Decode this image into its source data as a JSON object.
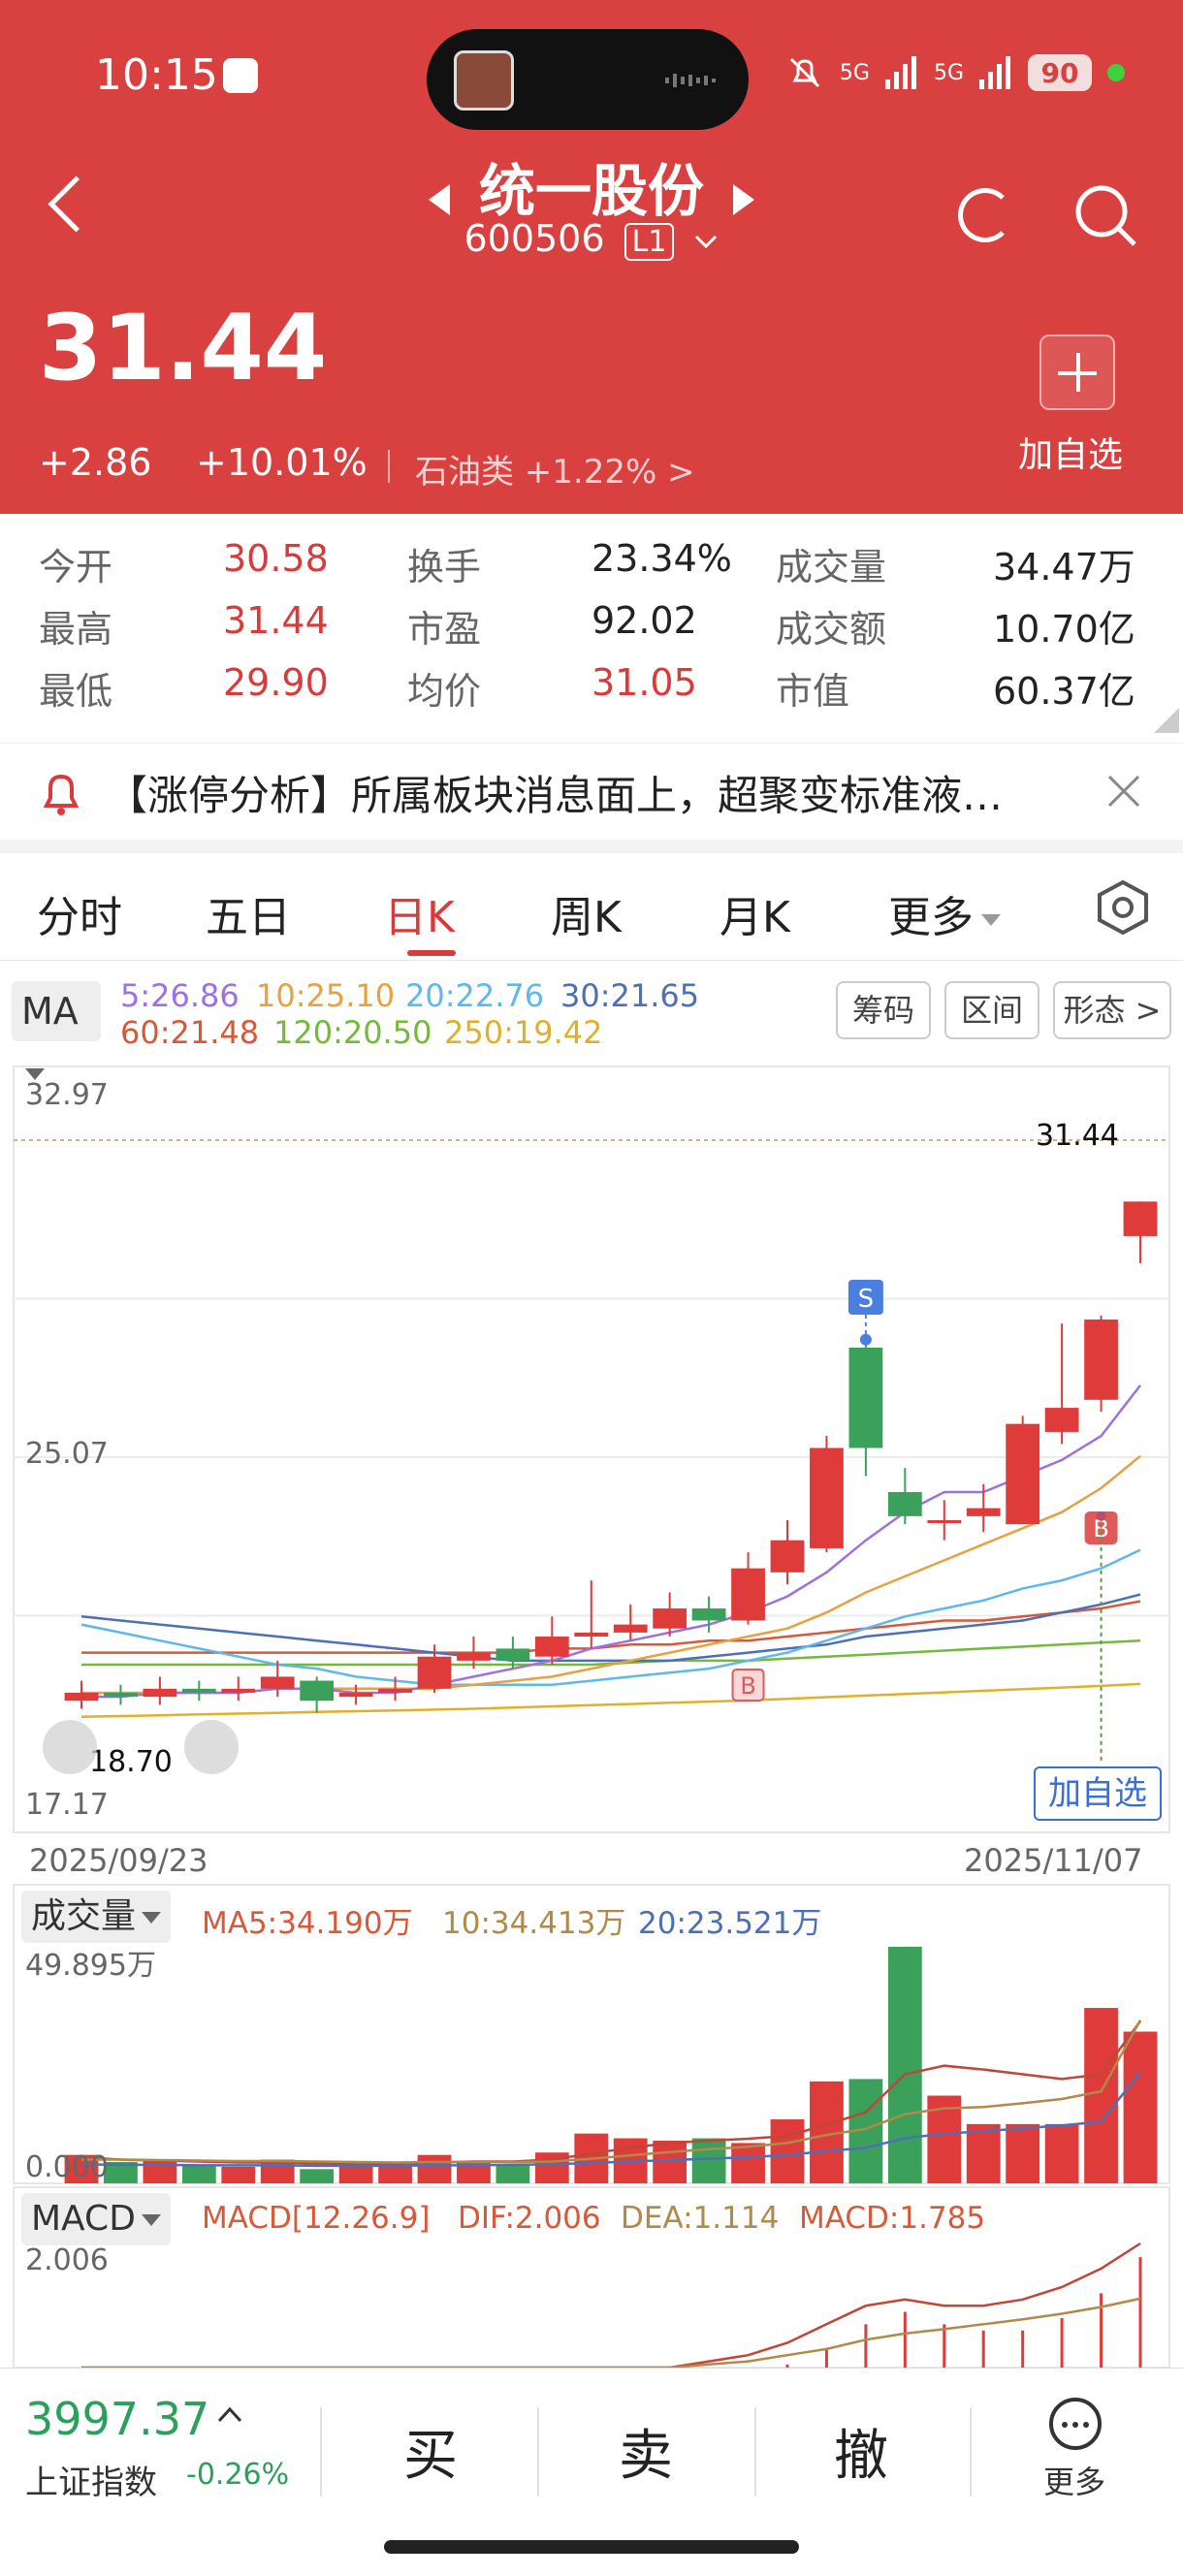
{
  "status_bar": {
    "time": "10:15",
    "battery": "90",
    "signal1": "5G",
    "signal2": "5G"
  },
  "header": {
    "title": "统一股份",
    "code": "600506",
    "level": "L1",
    "price": "31.44",
    "change": "+2.86",
    "change_pct": "+10.01%",
    "sector": "石油类 +1.22% >",
    "add_watch": "加自选"
  },
  "stats": [
    {
      "label": "今开",
      "value": "30.58",
      "color": "red"
    },
    {
      "label": "换手",
      "value": "23.34%",
      "color": "black"
    },
    {
      "label": "成交量",
      "value": "34.47万",
      "color": "black"
    },
    {
      "label": "最高",
      "value": "31.44",
      "color": "red"
    },
    {
      "label": "市盈",
      "value": "92.02",
      "color": "black"
    },
    {
      "label": "成交额",
      "value": "10.70亿",
      "color": "black"
    },
    {
      "label": "最低",
      "value": "29.90",
      "color": "red"
    },
    {
      "label": "均价",
      "value": "31.05",
      "color": "red"
    },
    {
      "label": "市值",
      "value": "60.37亿",
      "color": "black"
    }
  ],
  "news": {
    "text": "【涨停分析】所属板块消息面上，超聚变标准液…"
  },
  "tabs": {
    "t1": "分时",
    "t2": "五日",
    "t3": "日K",
    "t4": "周K",
    "t5": "月K",
    "t6": "更多",
    "active": "日K"
  },
  "ma": {
    "btn": "MA",
    "ma5": "5:26.86",
    "ma10": "10:25.10",
    "ma20": "20:22.76",
    "ma30": "30:21.65",
    "ma60": "60:21.48",
    "ma120": "120:20.50",
    "ma250": "250:19.42",
    "btn_chip": "筹码",
    "btn_range": "区间",
    "btn_pattern": "形态 >"
  },
  "axes": {
    "y_top": "32.97",
    "y_mid": "25.07",
    "y_bottom": "17.17",
    "low_mark": "18.70",
    "high_mark": "31.44",
    "date_start": "2025/09/23",
    "date_end": "2025/11/07",
    "sell_marker": "S",
    "buy_marker": "B",
    "add_watch_chart": "加自选"
  },
  "volume": {
    "btn": "成交量",
    "ma5": "MA5:34.190万",
    "ma10": "10:34.413万",
    "ma20": "20:23.521万",
    "max": "49.895万",
    "zero": "0.000"
  },
  "macd": {
    "btn": "MACD",
    "params": "MACD[12.26.9]",
    "dif": "DIF:2.006",
    "dea": "DEA:1.114",
    "macd": "MACD:1.785",
    "max": "2.006"
  },
  "bottom": {
    "index_value": "3997.37",
    "index_name": "上证指数",
    "index_change": "-0.26%",
    "buy": "买",
    "sell": "卖",
    "cancel": "撤",
    "more": "更多"
  },
  "colors": {
    "header_red": "#d94040",
    "up": "#e03b3b",
    "down": "#3aa05a",
    "ma5": "#9b72e0",
    "ma10": "#e8a040",
    "ma20": "#5fb8e8",
    "ma30": "#4d6fb8",
    "ma60": "#d65a3a",
    "ma120": "#76b83a",
    "ma250": "#e0b02a"
  },
  "chart_data": {
    "type": "candlestick",
    "x_range": [
      "2025/09/23",
      "2025/11/07"
    ],
    "ylim": [
      17.17,
      32.97
    ],
    "candles": [
      {
        "o": 19.0,
        "c": 19.2,
        "h": 19.5,
        "l": 18.8
      },
      {
        "o": 19.2,
        "c": 19.1,
        "h": 19.4,
        "l": 18.9
      },
      {
        "o": 19.1,
        "c": 19.3,
        "h": 19.6,
        "l": 18.9
      },
      {
        "o": 19.3,
        "c": 19.2,
        "h": 19.5,
        "l": 19.0
      },
      {
        "o": 19.2,
        "c": 19.3,
        "h": 19.6,
        "l": 19.0
      },
      {
        "o": 19.3,
        "c": 19.6,
        "h": 20.0,
        "l": 19.1
      },
      {
        "o": 19.5,
        "c": 19.0,
        "h": 19.6,
        "l": 18.7
      },
      {
        "o": 19.1,
        "c": 19.2,
        "h": 19.4,
        "l": 18.9
      },
      {
        "o": 19.2,
        "c": 19.3,
        "h": 19.6,
        "l": 19.0
      },
      {
        "o": 19.3,
        "c": 20.1,
        "h": 20.4,
        "l": 19.2
      },
      {
        "o": 20.0,
        "c": 20.2,
        "h": 20.6,
        "l": 19.8
      },
      {
        "o": 20.3,
        "c": 20.0,
        "h": 20.6,
        "l": 19.8
      },
      {
        "o": 20.1,
        "c": 20.6,
        "h": 21.1,
        "l": 19.9
      },
      {
        "o": 20.6,
        "c": 20.7,
        "h": 22.0,
        "l": 20.3
      },
      {
        "o": 20.7,
        "c": 20.9,
        "h": 21.4,
        "l": 20.5
      },
      {
        "o": 20.8,
        "c": 21.3,
        "h": 21.7,
        "l": 20.6
      },
      {
        "o": 21.3,
        "c": 21.0,
        "h": 21.6,
        "l": 20.7
      },
      {
        "o": 21.0,
        "c": 22.3,
        "h": 22.7,
        "l": 20.9
      },
      {
        "o": 22.2,
        "c": 23.0,
        "h": 23.5,
        "l": 21.9
      },
      {
        "o": 22.8,
        "c": 25.3,
        "h": 25.6,
        "l": 22.7
      },
      {
        "o": 27.8,
        "c": 25.3,
        "h": 28.0,
        "l": 24.6
      },
      {
        "o": 24.2,
        "c": 23.6,
        "h": 24.8,
        "l": 23.4
      },
      {
        "o": 23.5,
        "c": 23.5,
        "h": 24.0,
        "l": 23.0
      },
      {
        "o": 23.6,
        "c": 23.8,
        "h": 24.4,
        "l": 23.2
      },
      {
        "o": 23.4,
        "c": 25.9,
        "h": 26.1,
        "l": 23.4
      },
      {
        "o": 25.7,
        "c": 26.3,
        "h": 28.4,
        "l": 25.4
      },
      {
        "o": 26.5,
        "c": 28.5,
        "h": 28.6,
        "l": 26.2
      },
      {
        "o": 30.58,
        "c": 31.44,
        "h": 31.44,
        "l": 29.9
      }
    ],
    "ma_lines": {
      "ma5": [
        19.1,
        19.1,
        19.2,
        19.2,
        19.2,
        19.3,
        19.3,
        19.2,
        19.2,
        19.4,
        19.6,
        19.8,
        20.0,
        20.3,
        20.5,
        20.7,
        20.9,
        21.2,
        21.6,
        22.2,
        23.0,
        23.7,
        24.2,
        24.2,
        24.6,
        25.0,
        25.6,
        26.86
      ],
      "ma10": [
        19.2,
        19.2,
        19.2,
        19.2,
        19.2,
        19.3,
        19.3,
        19.3,
        19.3,
        19.3,
        19.4,
        19.5,
        19.6,
        19.8,
        20.0,
        20.2,
        20.4,
        20.6,
        20.8,
        21.2,
        21.7,
        22.1,
        22.5,
        22.9,
        23.3,
        23.7,
        24.3,
        25.1
      ],
      "ma20": [
        20.9,
        20.7,
        20.5,
        20.3,
        20.1,
        19.9,
        19.8,
        19.6,
        19.5,
        19.4,
        19.4,
        19.4,
        19.4,
        19.5,
        19.6,
        19.7,
        19.8,
        20.0,
        20.2,
        20.5,
        20.8,
        21.1,
        21.3,
        21.5,
        21.8,
        22.0,
        22.3,
        22.76
      ],
      "ma30": [
        21.1,
        21.0,
        20.9,
        20.8,
        20.7,
        20.6,
        20.5,
        20.4,
        20.3,
        20.2,
        20.1,
        20.0,
        20.0,
        20.0,
        20.0,
        20.0,
        20.1,
        20.2,
        20.3,
        20.4,
        20.6,
        20.7,
        20.8,
        20.9,
        21.0,
        21.2,
        21.4,
        21.65
      ],
      "ma60": [
        20.2,
        20.2,
        20.2,
        20.2,
        20.2,
        20.2,
        20.2,
        20.2,
        20.2,
        20.2,
        20.2,
        20.2,
        20.3,
        20.3,
        20.4,
        20.4,
        20.5,
        20.5,
        20.6,
        20.7,
        20.8,
        20.9,
        21.0,
        21.0,
        21.1,
        21.2,
        21.3,
        21.48
      ],
      "ma120": [
        19.9,
        19.9,
        19.9,
        19.9,
        19.9,
        19.9,
        19.9,
        19.9,
        19.9,
        19.9,
        19.9,
        19.9,
        19.9,
        19.9,
        19.95,
        20.0,
        20.0,
        20.0,
        20.05,
        20.1,
        20.15,
        20.2,
        20.25,
        20.3,
        20.35,
        20.4,
        20.45,
        20.5
      ],
      "ma250": [
        18.6,
        18.62,
        18.64,
        18.66,
        18.68,
        18.7,
        18.72,
        18.74,
        18.76,
        18.78,
        18.8,
        18.83,
        18.86,
        18.89,
        18.92,
        18.95,
        18.98,
        19.01,
        19.05,
        19.09,
        19.13,
        19.17,
        19.21,
        19.25,
        19.29,
        19.33,
        19.37,
        19.42
      ]
    },
    "volume": [
      6.0,
      4.5,
      5.0,
      4.0,
      3.5,
      5.0,
      3.0,
      3.5,
      3.8,
      6.0,
      4.5,
      4.0,
      6.5,
      10.5,
      9.5,
      9.0,
      9.5,
      8.5,
      13.5,
      21.5,
      22.0,
      49.895,
      18.5,
      12.5,
      12.5,
      12.5,
      37.0,
      32.0
    ],
    "vol_ma5": [
      5.5,
      5.0,
      4.8,
      4.6,
      4.4,
      4.4,
      4.2,
      4.0,
      4.0,
      4.4,
      4.6,
      4.6,
      5.0,
      6.3,
      7.5,
      8.5,
      9.0,
      9.4,
      10.0,
      12.4,
      15.0,
      23.0,
      24.8,
      24.0,
      23.0,
      22.0,
      23.0,
      34.19
    ],
    "vol_ma10": [
      5.0,
      5.0,
      4.9,
      4.8,
      4.7,
      4.7,
      4.6,
      4.5,
      4.4,
      4.5,
      4.5,
      4.5,
      4.6,
      5.2,
      5.9,
      6.6,
      7.2,
      7.7,
      8.5,
      10.2,
      11.5,
      14.6,
      15.8,
      16.1,
      16.9,
      17.8,
      19.4,
      34.41
    ],
    "vol_ma20": [
      4.0,
      3.9,
      3.9,
      3.8,
      3.8,
      3.8,
      3.7,
      3.7,
      3.7,
      3.8,
      3.8,
      3.9,
      4.0,
      4.3,
      4.6,
      4.9,
      5.2,
      5.5,
      6.0,
      6.8,
      7.5,
      9.5,
      10.5,
      11.0,
      11.6,
      12.2,
      13.0,
      23.52
    ],
    "macd_hist": [
      0,
      0,
      0,
      0,
      0,
      0,
      0,
      0,
      0,
      0,
      0,
      0,
      0,
      0,
      0,
      0,
      0,
      0,
      0.05,
      0.3,
      0.7,
      0.9,
      0.7,
      0.6,
      0.6,
      0.8,
      1.2,
      1.785
    ],
    "macd_dif": [
      0,
      0,
      0,
      0,
      0,
      0,
      0,
      0,
      0,
      0,
      0,
      0,
      0,
      0,
      0,
      0,
      0.1,
      0.2,
      0.4,
      0.7,
      1.0,
      1.1,
      1.0,
      1.0,
      1.1,
      1.3,
      1.6,
      2.006
    ],
    "macd_dea": [
      0,
      0,
      0,
      0,
      0,
      0,
      0,
      0,
      0,
      0,
      0,
      0,
      0,
      0,
      0,
      0,
      0.05,
      0.1,
      0.2,
      0.3,
      0.45,
      0.55,
      0.62,
      0.7,
      0.78,
      0.87,
      0.98,
      1.114
    ]
  }
}
